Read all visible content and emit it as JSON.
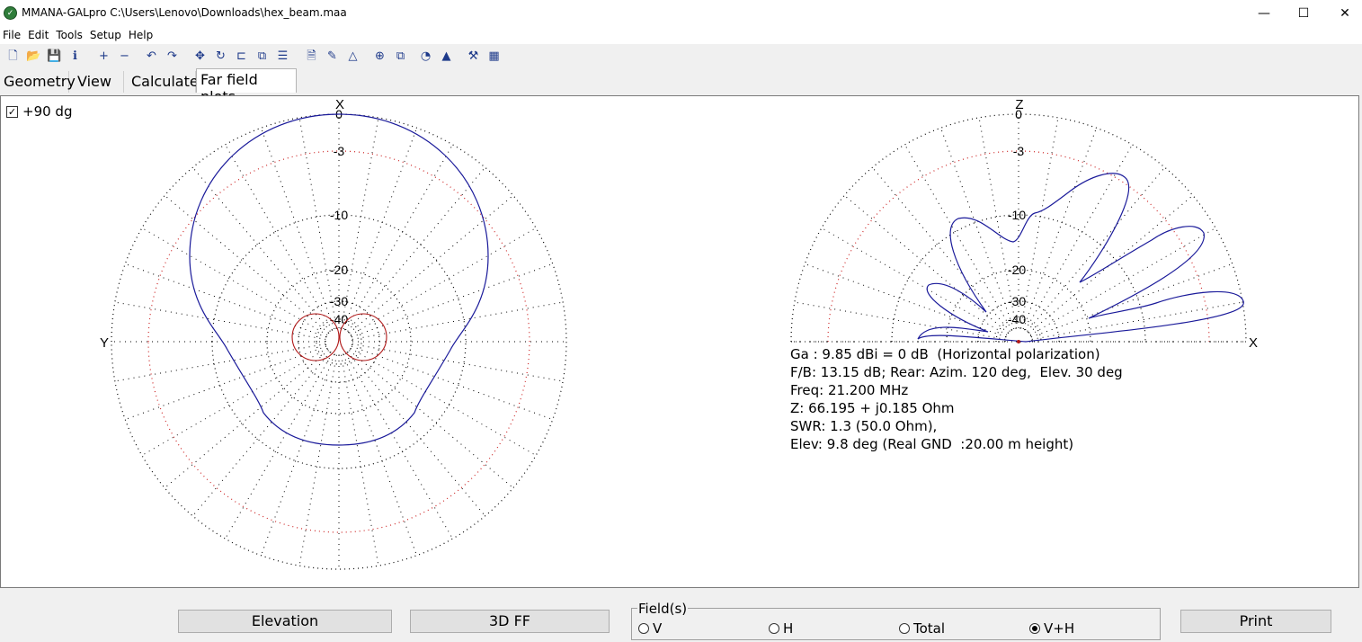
{
  "window": {
    "title": "MMANA-GALpro C:\\Users\\Lenovo\\Downloads\\hex_beam.maa",
    "minimize": "—",
    "maximize": "☐",
    "close": "✕"
  },
  "menu": [
    "File",
    "Edit",
    "Tools",
    "Setup",
    "Help"
  ],
  "toolbar_icons": [
    {
      "name": "new-file-icon",
      "glyph": "🗋"
    },
    {
      "name": "open-folder-icon",
      "glyph": "📂"
    },
    {
      "name": "save-icon",
      "glyph": "💾"
    },
    {
      "name": "info-icon",
      "glyph": "ℹ"
    },
    {
      "name": "add-icon",
      "glyph": "+"
    },
    {
      "name": "remove-icon",
      "glyph": "−"
    },
    {
      "name": "undo-icon",
      "glyph": "↶"
    },
    {
      "name": "redo-icon",
      "glyph": "↷"
    },
    {
      "name": "move-icon",
      "glyph": "✥"
    },
    {
      "name": "rotate-icon",
      "glyph": "↻"
    },
    {
      "name": "stretch-icon",
      "glyph": "⊏"
    },
    {
      "name": "copy-element-icon",
      "glyph": "⧉"
    },
    {
      "name": "split-icon",
      "glyph": "☰"
    },
    {
      "name": "sheet-icon",
      "glyph": "🗎"
    },
    {
      "name": "edit-icon",
      "glyph": "✎"
    },
    {
      "name": "triangle-icon",
      "glyph": "△"
    },
    {
      "name": "target-icon",
      "glyph": "⊕"
    },
    {
      "name": "copy-icon",
      "glyph": "⧉"
    },
    {
      "name": "pattern-icon",
      "glyph": "◔"
    },
    {
      "name": "color-3d-icon",
      "glyph": "▲"
    },
    {
      "name": "tools-icon",
      "glyph": "⚒"
    },
    {
      "name": "calculator-icon",
      "glyph": "▦"
    }
  ],
  "tabs": [
    "Geometry",
    "View",
    "Calculate",
    "Far field plots"
  ],
  "active_tab": 3,
  "checkbox": {
    "label": "+90 dg",
    "checked": true
  },
  "colors": {
    "total_pattern": "#1a1a9a",
    "secondary_pattern": "#b01818",
    "grid_dot": "#000000",
    "grid_red": "#cc2222"
  },
  "azimuth_plot": {
    "axis_top": "X",
    "axis_left": "Y",
    "ring_labels": [
      "0",
      "-3",
      "-10",
      "-20",
      "-30",
      "-40"
    ],
    "ring_db": [
      0,
      -3,
      -10,
      -20,
      -30,
      -40
    ],
    "forward_gain_db": 0,
    "rear_gain_db": -13.15
  },
  "elevation_plot": {
    "axis_top": "Z",
    "axis_right": "X",
    "ring_labels": [
      "0",
      "-3",
      "-10",
      "-20",
      "-30",
      "-40"
    ],
    "lobe_elevations_deg": [
      9.8,
      27,
      48
    ]
  },
  "info_lines": [
    "Ga : 9.85 dBi = 0 dB  (Horizontal polarization)",
    "F/B: 13.15 dB; Rear: Azim. 120 deg,  Elev. 30 deg",
    "Freq: 21.200 MHz",
    "Z: 66.195 + j0.185 Ohm",
    "SWR: 1.3 (50.0 Ohm),",
    "Elev: 9.8 deg (Real GND  :20.00 m height)"
  ],
  "buttons": {
    "elevation": "Elevation",
    "ff3d": "3D FF",
    "print": "Print"
  },
  "fields": {
    "legend": "Field(s)",
    "options": [
      "V",
      "H",
      "Total",
      "V+H"
    ],
    "selected": 3
  }
}
